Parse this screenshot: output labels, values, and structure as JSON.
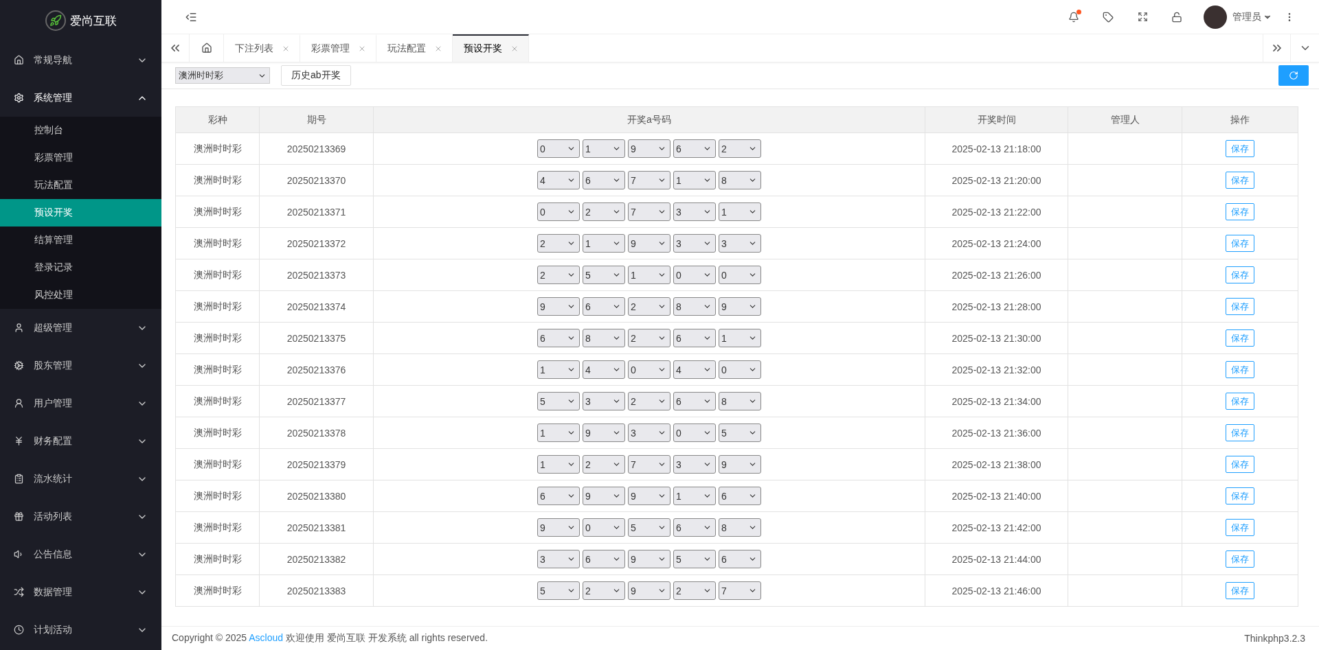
{
  "brand": {
    "name": "爱尚互联"
  },
  "header": {
    "user_name": "管理员",
    "notification_unread": true
  },
  "sidebar": {
    "items": [
      {
        "label": "常规导航",
        "expanded": false
      },
      {
        "label": "系统管理",
        "expanded": true,
        "children": [
          {
            "label": "控制台",
            "selected": false
          },
          {
            "label": "彩票管理",
            "selected": false
          },
          {
            "label": "玩法配置",
            "selected": false
          },
          {
            "label": "预设开奖",
            "selected": true
          },
          {
            "label": "结算管理",
            "selected": false
          },
          {
            "label": "登录记录",
            "selected": false
          },
          {
            "label": "风控处理",
            "selected": false
          }
        ]
      },
      {
        "label": "超级管理",
        "expanded": false
      },
      {
        "label": "股东管理",
        "expanded": false
      },
      {
        "label": "用户管理",
        "expanded": false
      },
      {
        "label": "财务配置",
        "expanded": false
      },
      {
        "label": "流水统计",
        "expanded": false
      },
      {
        "label": "活动列表",
        "expanded": false
      },
      {
        "label": "公告信息",
        "expanded": false
      },
      {
        "label": "数据管理",
        "expanded": false
      },
      {
        "label": "计划活动",
        "expanded": false
      }
    ]
  },
  "tabs": [
    {
      "label": "下注列表",
      "selected": false
    },
    {
      "label": "彩票管理",
      "selected": false
    },
    {
      "label": "玩法配置",
      "selected": false
    },
    {
      "label": "预设开奖",
      "selected": true
    }
  ],
  "toolbar": {
    "lottery_select": "澳洲时时彩",
    "history_button": "历史ab开奖"
  },
  "table": {
    "columns": [
      "彩种",
      "期号",
      "开奖a号码",
      "开奖时间",
      "管理人",
      "操作"
    ],
    "rows": [
      {
        "lottery": "澳洲时时彩",
        "issue": "20250213369",
        "numbers": [
          "0",
          "1",
          "9",
          "6",
          "2"
        ],
        "draw_time": "2025-02-13 21:18:00",
        "action": "保存"
      },
      {
        "lottery": "澳洲时时彩",
        "issue": "20250213370",
        "numbers": [
          "4",
          "6",
          "7",
          "1",
          "8"
        ],
        "draw_time": "2025-02-13 21:20:00",
        "action": "保存"
      },
      {
        "lottery": "澳洲时时彩",
        "issue": "20250213371",
        "numbers": [
          "0",
          "2",
          "7",
          "3",
          "1"
        ],
        "draw_time": "2025-02-13 21:22:00",
        "action": "保存"
      },
      {
        "lottery": "澳洲时时彩",
        "issue": "20250213372",
        "numbers": [
          "2",
          "1",
          "9",
          "3",
          "3"
        ],
        "draw_time": "2025-02-13 21:24:00",
        "action": "保存"
      },
      {
        "lottery": "澳洲时时彩",
        "issue": "20250213373",
        "numbers": [
          "2",
          "5",
          "1",
          "0",
          "0"
        ],
        "draw_time": "2025-02-13 21:26:00",
        "action": "保存"
      },
      {
        "lottery": "澳洲时时彩",
        "issue": "20250213374",
        "numbers": [
          "9",
          "6",
          "2",
          "8",
          "9"
        ],
        "draw_time": "2025-02-13 21:28:00",
        "action": "保存"
      },
      {
        "lottery": "澳洲时时彩",
        "issue": "20250213375",
        "numbers": [
          "6",
          "8",
          "2",
          "6",
          "1"
        ],
        "draw_time": "2025-02-13 21:30:00",
        "action": "保存"
      },
      {
        "lottery": "澳洲时时彩",
        "issue": "20250213376",
        "numbers": [
          "1",
          "4",
          "0",
          "4",
          "0"
        ],
        "draw_time": "2025-02-13 21:32:00",
        "action": "保存"
      },
      {
        "lottery": "澳洲时时彩",
        "issue": "20250213377",
        "numbers": [
          "5",
          "3",
          "2",
          "6",
          "8"
        ],
        "draw_time": "2025-02-13 21:34:00",
        "action": "保存"
      },
      {
        "lottery": "澳洲时时彩",
        "issue": "20250213378",
        "numbers": [
          "1",
          "9",
          "3",
          "0",
          "5"
        ],
        "draw_time": "2025-02-13 21:36:00",
        "action": "保存"
      },
      {
        "lottery": "澳洲时时彩",
        "issue": "20250213379",
        "numbers": [
          "1",
          "2",
          "7",
          "3",
          "9"
        ],
        "draw_time": "2025-02-13 21:38:00",
        "action": "保存"
      },
      {
        "lottery": "澳洲时时彩",
        "issue": "20250213380",
        "numbers": [
          "6",
          "9",
          "9",
          "1",
          "6"
        ],
        "draw_time": "2025-02-13 21:40:00",
        "action": "保存"
      },
      {
        "lottery": "澳洲时时彩",
        "issue": "20250213381",
        "numbers": [
          "9",
          "0",
          "5",
          "6",
          "8"
        ],
        "draw_time": "2025-02-13 21:42:00",
        "action": "保存"
      },
      {
        "lottery": "澳洲时时彩",
        "issue": "20250213382",
        "numbers": [
          "3",
          "6",
          "9",
          "5",
          "6"
        ],
        "draw_time": "2025-02-13 21:44:00",
        "action": "保存"
      },
      {
        "lottery": "澳洲时时彩",
        "issue": "20250213383",
        "numbers": [
          "5",
          "2",
          "9",
          "2",
          "7"
        ],
        "draw_time": "2025-02-13 21:46:00",
        "action": "保存"
      }
    ]
  },
  "footer": {
    "copyright_prefix": "Copyright © 2025",
    "link": "Ascloud",
    "copyright_suffix": "欢迎使用 爱尚互联 开发系统 all rights reserved.",
    "version": "Thinkphp3.2.3"
  }
}
